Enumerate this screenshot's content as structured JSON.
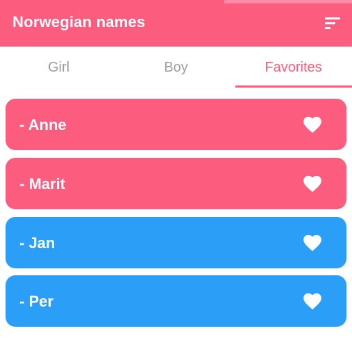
{
  "colors": {
    "girl": "#fc5c7d",
    "boy": "#2b9ef8",
    "accent": "#fc5c7d"
  },
  "header": {
    "title": "Norwegian names",
    "sort_icon": "sort-icon"
  },
  "tabs": [
    {
      "label": "Girl",
      "active": false
    },
    {
      "label": "Boy",
      "active": false
    },
    {
      "label": "Favorites",
      "active": true
    }
  ],
  "favorites": [
    {
      "name": "- Anne",
      "gender": "girl",
      "icon": "heart-icon"
    },
    {
      "name": "- Marit",
      "gender": "girl",
      "icon": "heart-icon"
    },
    {
      "name": "- Jan",
      "gender": "boy",
      "icon": "heart-icon"
    },
    {
      "name": "- Per",
      "gender": "boy",
      "icon": "heart-icon"
    }
  ]
}
